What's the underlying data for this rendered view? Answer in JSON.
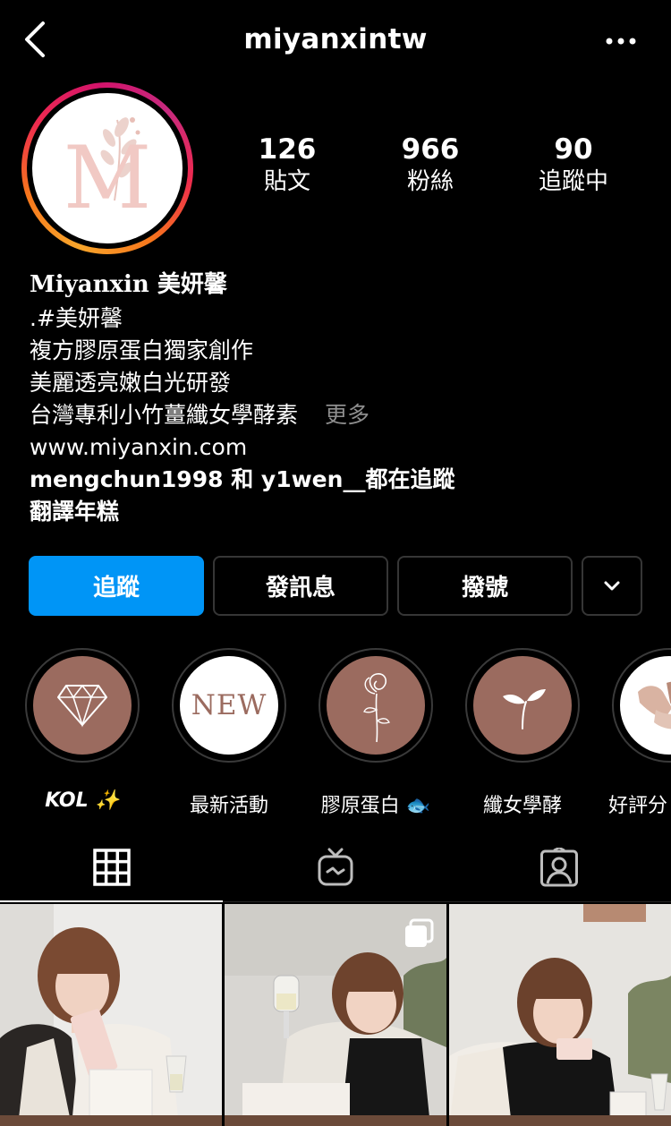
{
  "header": {
    "username": "miyanxintw",
    "back_icon": "chevron-left-icon",
    "more_icon": "ellipsis-icon"
  },
  "profile": {
    "avatar_letter": "M",
    "stats": [
      {
        "num": "126",
        "label": "貼文"
      },
      {
        "num": "966",
        "label": "粉絲"
      },
      {
        "num": "90",
        "label": "追蹤中"
      }
    ]
  },
  "bio": {
    "name": "Miyanxin 美妍馨",
    "lines": [
      ".#美妍馨",
      "複方膠原蛋白獨家創作",
      "美麗透亮嫩白光研發",
      "台灣專利小竹薑纖女學酵素"
    ],
    "more": "更多",
    "website": "www.miyanxin.com",
    "followed_by": "mengchun1998 和 y1wen__都在追蹤",
    "translate": "翻譯年糕"
  },
  "actions": {
    "follow": "追蹤",
    "message": "發訊息",
    "call": "撥號",
    "dropdown_icon": "chevron-down-icon"
  },
  "highlights": [
    {
      "label": "KOL ✨",
      "icon": "diamond-icon"
    },
    {
      "label": "最新活動",
      "text": "NEW"
    },
    {
      "label": "膠原蛋白 🐟",
      "icon": "rose-icon"
    },
    {
      "label": "纖女學酵",
      "icon": "sprout-icon"
    },
    {
      "label": "好評分",
      "icon": "hands-icon"
    }
  ],
  "tabs": [
    "grid-icon",
    "igtv-icon",
    "tagged-icon"
  ],
  "colors": {
    "follow_blue": "#0095f6",
    "highlight_brown": "#9b6b5f",
    "avatar_pink": "#f1c9c4"
  }
}
